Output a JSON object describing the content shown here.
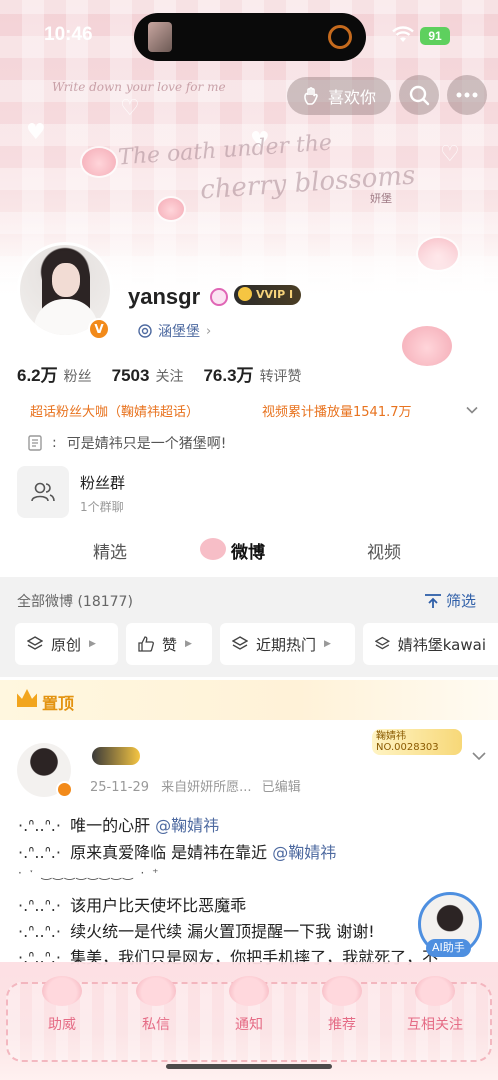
{
  "status_bar": {
    "time": "10:46",
    "battery": "91"
  },
  "header": {
    "deco_script_1": "Write down your love for me",
    "deco_script_2": "The oath under the",
    "deco_script_3": "cherry blossoms",
    "deco_tag": "妍堡",
    "like_label": "喜欢你"
  },
  "profile": {
    "username": "yansgr",
    "vvip_label": "VVIP I",
    "fan_group_link": "涵堡堡",
    "stats": [
      {
        "num": "6.2万",
        "label": "粉丝"
      },
      {
        "num": "7503",
        "label": "关注"
      },
      {
        "num": "76.3万",
        "label": "转评赞"
      }
    ],
    "tag_1": "超话粉丝大咖（鞠婧祎超话）",
    "tag_2": "视频累计播放量1541.7万",
    "bio": "可是婧祎只是一个猪堡啊!",
    "fan_card_title": "粉丝群",
    "fan_card_sub": "1个群聊"
  },
  "tabs": [
    "精选",
    "微博",
    "视频"
  ],
  "feed": {
    "count": "全部微博 (18177)",
    "filter": "筛选",
    "chips": [
      "原创",
      "赞",
      "近期热门",
      "婧祎堡kawai"
    ],
    "pinned": "置顶"
  },
  "post": {
    "time": "25-11-29",
    "source": "来自妍妍所愿...",
    "edited": "已编辑",
    "fans_card_name": "鞠婧祎",
    "fans_card_no": "NO.0028303",
    "kaomoji": "·.ᐢ..ᐢ.·",
    "lines": [
      {
        "text": "唯一的心肝",
        "mention": "@鞠婧祎"
      },
      {
        "text": "原来真爱降临 是婧祎在靠近",
        "mention": "@鞠婧祎"
      },
      {
        "text": "·  ˑ  ‿‿‿‿‿‿‿‿  ·  ⁺",
        "mention": ""
      },
      {
        "text": "该用户比天使坏比恶魔乖",
        "mention": ""
      },
      {
        "text": "续火统一是代续 漏火置顶提醒一下我 谢谢!",
        "mention": ""
      },
      {
        "text": "集美，我们只是网友，你把手机摔了，我就死了，不",
        "mention": ""
      }
    ]
  },
  "ai_button": "AI助手",
  "bottom_nav": [
    "助威",
    "私信",
    "通知",
    "推荐",
    "互相关注"
  ],
  "colors": {
    "accent_orange": "#e8731f",
    "link_blue": "#4e6aa0",
    "nav_pink": "#e56c86"
  }
}
